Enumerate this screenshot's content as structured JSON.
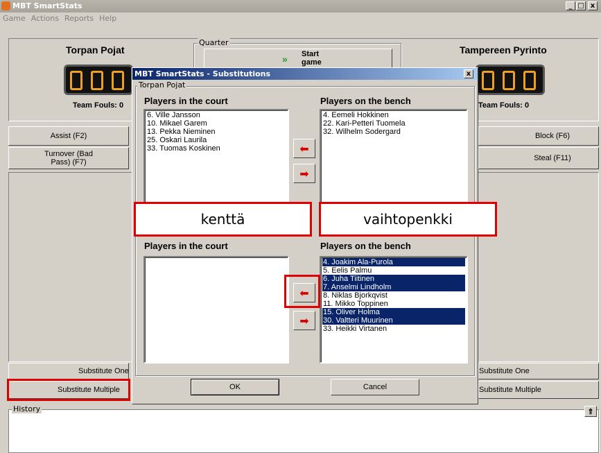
{
  "window": {
    "title": "MBT SmartStats",
    "min": "_",
    "max": "□",
    "close": "x"
  },
  "menu": [
    "Game",
    "Actions",
    "Reports",
    "Help"
  ],
  "home": {
    "name": "Torpan Pojat",
    "fouls": "Team Fouls: 0"
  },
  "away": {
    "name": "Tampereen Pyrinto",
    "fouls": "Team Fouls: 0"
  },
  "quarter": {
    "label": "Quarter",
    "start_label": "Start game"
  },
  "actions": {
    "assist": "Assist (F2)",
    "turnover": "Turnover (Bad Pass) (F7)",
    "block": "Block (F6)",
    "steal": "Steal (F11)",
    "sub_one_left": "Substitute One",
    "sub_multi_left": "Substitute Multiple",
    "sub_one_right": "Substitute One",
    "sub_multi_right": "Substitute Multiple"
  },
  "history": {
    "label": "History"
  },
  "dialog": {
    "title": "MBT SmartStats - Substitutions",
    "close": "x",
    "group1_label": "Torpan Pojat",
    "court_header": "Players in the court",
    "bench_header": "Players on the bench",
    "top_court": [
      "6. Ville Jansson",
      "10. Mikael Garem",
      "13. Pekka Nieminen",
      "25. Oskari Laurila",
      "33. Tuomas Koskinen"
    ],
    "top_bench": [
      "4. Eemeli Hokkinen",
      "22. Kari-Petteri Tuomela",
      "32. Wilhelm Sodergard"
    ],
    "bottom_court": [],
    "bottom_bench": [
      {
        "name": "4. Joakim Ala-Purola",
        "selected": true
      },
      {
        "name": "5. Eelis Palmu",
        "selected": false
      },
      {
        "name": "6. Juha Tiitinen",
        "selected": true
      },
      {
        "name": "7. Anselmi Lindholm",
        "selected": true
      },
      {
        "name": "8. Niklas Bjorkqvist",
        "selected": false
      },
      {
        "name": "11. Mikko Toppinen",
        "selected": false
      },
      {
        "name": "15. Oliver Holma",
        "selected": true
      },
      {
        "name": "30. Valtteri Muurinen",
        "selected": true
      },
      {
        "name": "33. Heikki Virtanen",
        "selected": false
      }
    ],
    "ok": "OK",
    "cancel": "Cancel"
  },
  "annotations": {
    "court": "kenttä",
    "bench": "vaihtopenkki"
  },
  "colors": {
    "selection": "#0a246a",
    "annotation": "#e00000",
    "arrow": "#d00000",
    "score": "#f0a020"
  }
}
